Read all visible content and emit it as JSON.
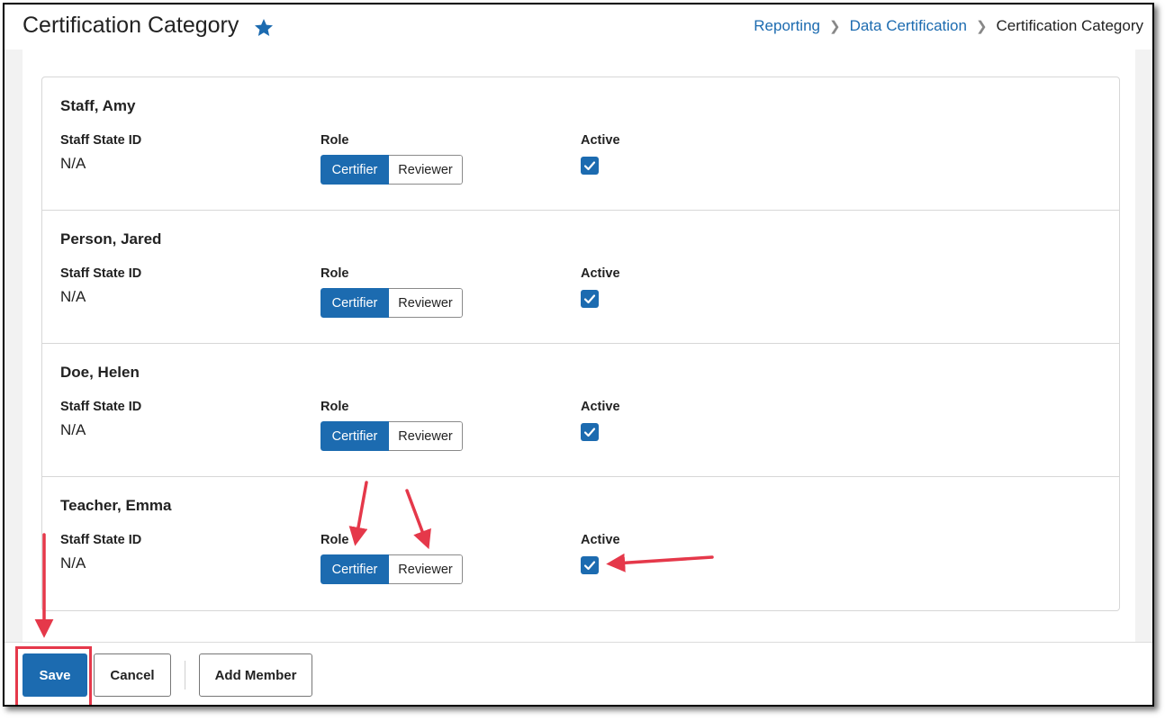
{
  "header": {
    "title": "Certification Category",
    "breadcrumb": [
      {
        "label": "Reporting"
      },
      {
        "label": "Data Certification"
      },
      {
        "label": "Certification Category"
      }
    ]
  },
  "labels": {
    "staff_state_id": "Staff State ID",
    "role": "Role",
    "active": "Active"
  },
  "role_options": {
    "certifier": "Certifier",
    "reviewer": "Reviewer"
  },
  "members": [
    {
      "name": "Staff, Amy",
      "staff_state_id": "N/A",
      "selected_role": "Certifier",
      "active": true
    },
    {
      "name": "Person, Jared",
      "staff_state_id": "N/A",
      "selected_role": "Certifier",
      "active": true
    },
    {
      "name": "Doe, Helen",
      "staff_state_id": "N/A",
      "selected_role": "Certifier",
      "active": true
    },
    {
      "name": "Teacher, Emma",
      "staff_state_id": "N/A",
      "selected_role": "Certifier",
      "active": true
    }
  ],
  "footer": {
    "save_label": "Save",
    "cancel_label": "Cancel",
    "add_member_label": "Add Member"
  },
  "colors": {
    "accent": "#1c6bb0",
    "annotation": "#e5384a"
  }
}
